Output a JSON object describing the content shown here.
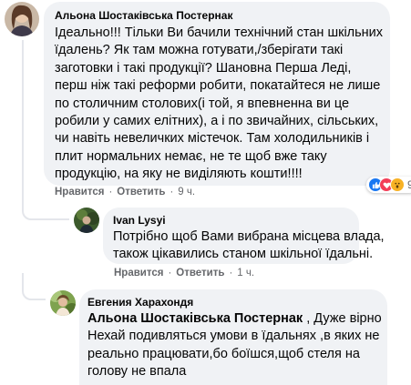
{
  "comments": [
    {
      "author": "Альона Шостаківська Постернак",
      "lines": [
        "Ідеально!!! Тільки Ви бачили технічний стан шкільних",
        "їдалень? Як там можна готувати,/зберігати такі",
        "заготовки і такі продукції? Шановна Перша Леді,",
        "перш ніж такі реформи робити, покатайтеся не лише",
        "по столичним столових(і той, я впевненна ви це",
        "робили у самих елітних), а і по звичайних, сільських,",
        "чи навіть невеличких містечок. Там холодильників і",
        "плит нормальних немає, не те щоб вже таку",
        "продукцію, на яку не виділяють кошти!!!!"
      ],
      "like_label": "Нравится",
      "reply_label": "Ответить",
      "time": "9 ч.",
      "reaction_count": "9",
      "reactions": [
        "like-icon",
        "love-icon",
        "wow-icon"
      ]
    },
    {
      "author": "Ivan Lysyi",
      "lines": [
        "Потрібно щоб Вами вибрана місцева влада,",
        "також цікавились станом шкільної їдальні."
      ],
      "like_label": "Нравится",
      "reply_label": "Ответить",
      "time": "1 ч."
    },
    {
      "author": "Евгения Харахондя",
      "mention": "Альона Шостаківська Постернак",
      "mention_suffix": " , Дуже вірно",
      "lines": [
        "Нехай подивляться умови в їдальнях ,в яких не",
        "реально працювати,бо боїшся,щоб стеля на",
        "голову не впала"
      ]
    }
  ],
  "colors": {
    "bubble": "#f0f2f5",
    "meta_text": "#65676b",
    "like_blue": "#1877f2",
    "love_red": "#f33e58",
    "wow_yellow": "#f7b125"
  }
}
